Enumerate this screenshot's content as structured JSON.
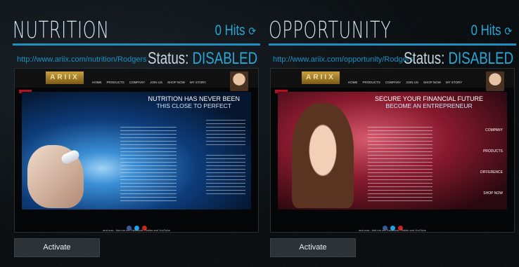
{
  "panels": [
    {
      "title": "NUTRITION",
      "hits": "0 Hits",
      "url": "http://www.ariix.com/nutrition/Rodgers",
      "status_label": "Status:",
      "status_value": "DISABLED",
      "site": {
        "logo": "ARIIX",
        "nav": [
          "HOME",
          "PRODUCTS",
          "COMPANY",
          "JOIN US",
          "SHOP NOW",
          "MY STORY"
        ],
        "headline": "NUTRITION HAS NEVER BEEN",
        "subheadline": "THIS CLOSE TO PERFECT",
        "footer": "and now - find me on: Facebook, Twitter and YouTube"
      },
      "activate_label": "Activate"
    },
    {
      "title": "OPPORTUNITY",
      "hits": "0 Hits",
      "url": "http://www.ariix.com/opportunity/Rodgers",
      "status_label": "Status:",
      "status_value": "DISABLED",
      "site": {
        "logo": "ARIIX",
        "nav": [
          "HOME",
          "PRODUCTS",
          "COMPANY",
          "JOIN US",
          "SHOP NOW",
          "MY STORY"
        ],
        "headline": "SECURE YOUR FINANCIAL FUTURE",
        "subheadline": "BECOME AN ENTREPRENEUR",
        "side_items": [
          "COMPANY",
          "PRODUCTS",
          "DIFFERENCE",
          "SHOP NOW"
        ],
        "footer": "and now - find me on: Facebook, Twitter and YouTube"
      },
      "activate_label": "Activate"
    }
  ],
  "colors": {
    "accent": "#29a7d6",
    "rule": "#1e8fbf",
    "title": "#cfe3ea"
  }
}
